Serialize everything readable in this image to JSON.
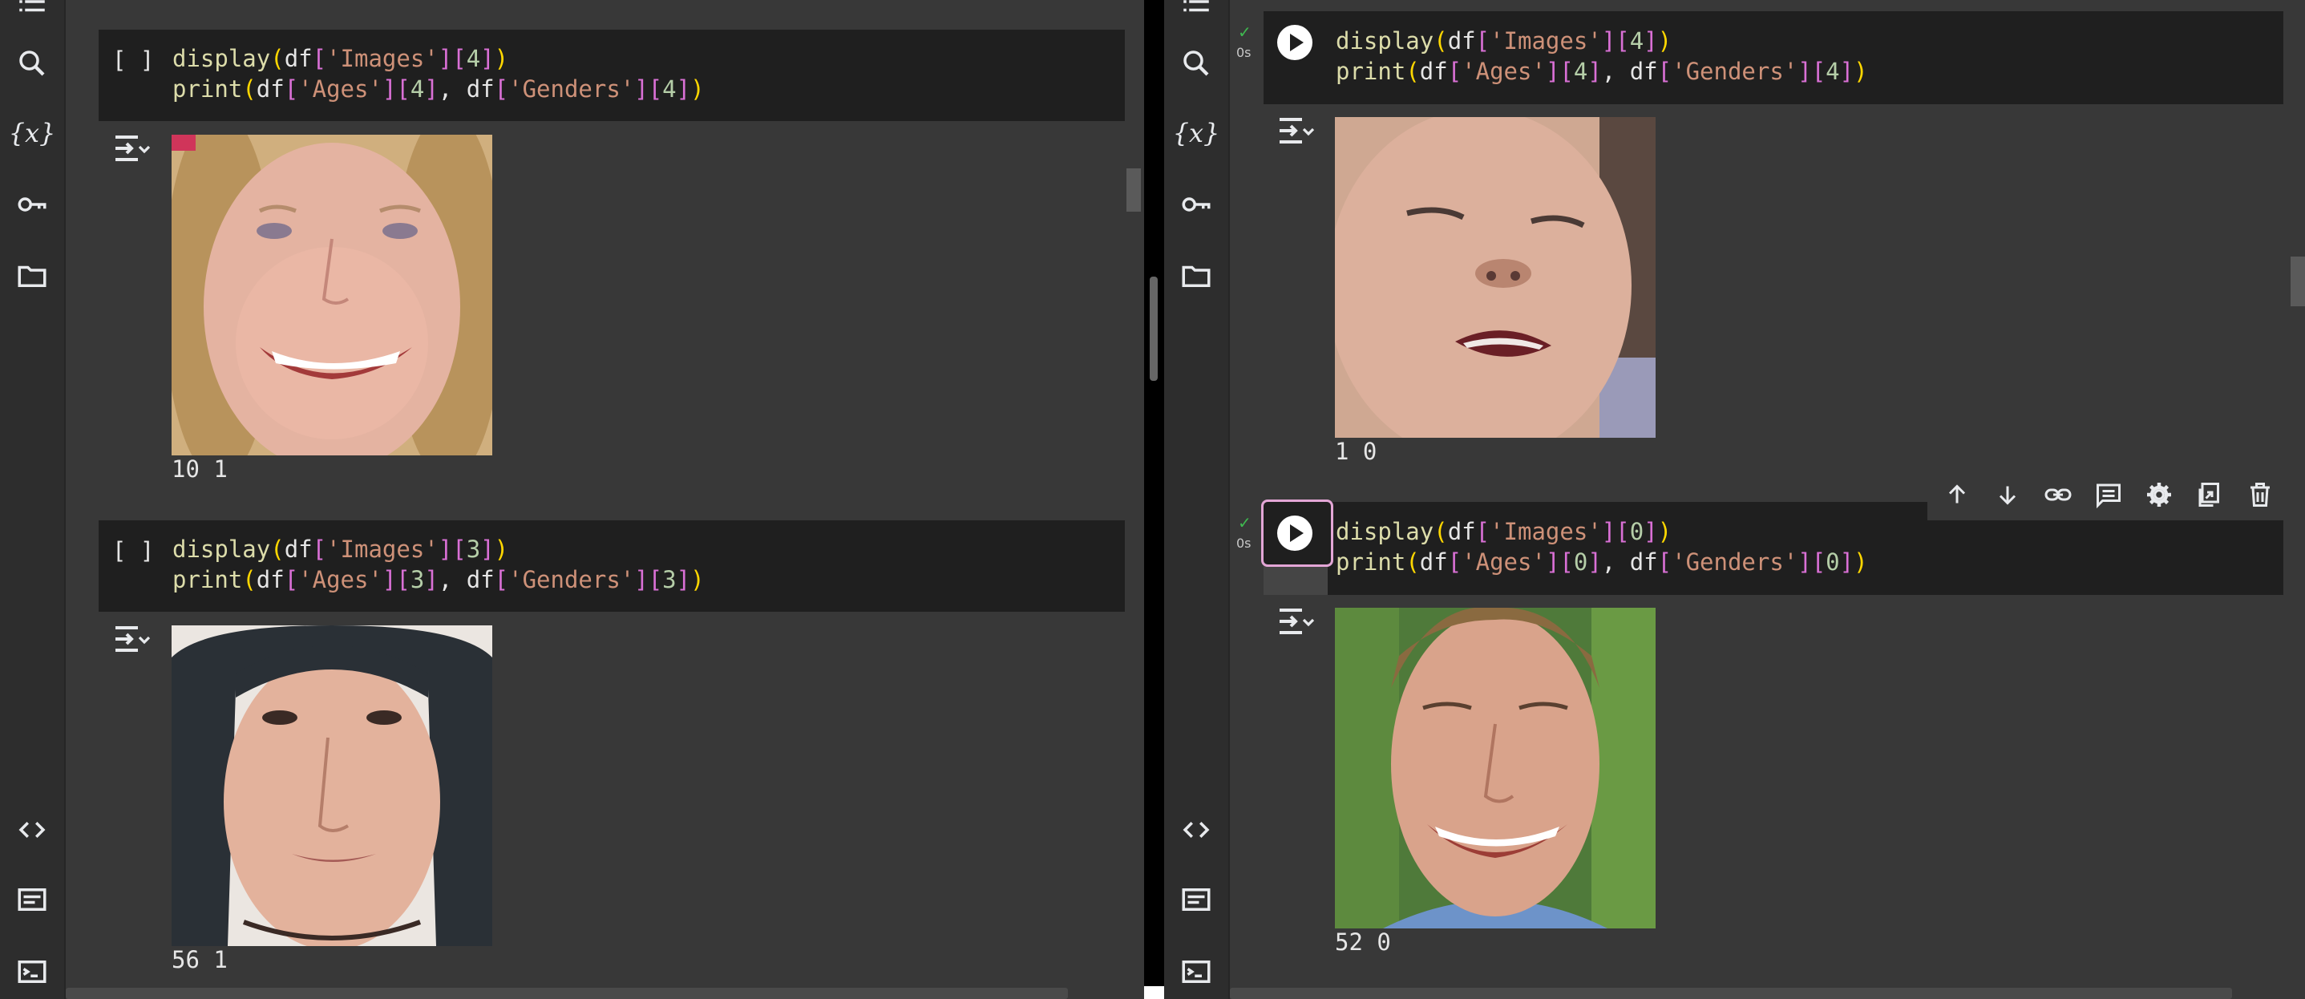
{
  "rail_icons": [
    "list-icon",
    "search-icon",
    "variables-icon",
    "key-icon",
    "folder-icon",
    "code-icon",
    "snippets-icon",
    "terminal-icon"
  ],
  "variables_glyph": "{x}",
  "empty_run_indicator": "[ ]",
  "left": {
    "cells": [
      {
        "code": [
          "display(df['Images'][4])",
          "print(df['Ages'][4], df['Genders'][4])"
        ],
        "output_text": "10 1",
        "image_name": "child-face-image"
      },
      {
        "code": [
          "display(df['Images'][3])",
          "print(df['Ages'][3], df['Genders'][3])"
        ],
        "output_text": "56 1",
        "image_name": "woman-face-image"
      }
    ]
  },
  "right": {
    "cells": [
      {
        "status_check": "✓",
        "status_time": "0s",
        "code": [
          "display(df['Images'][4])",
          "print(df['Ages'][4], df['Genders'][4])"
        ],
        "output_text": "1 0",
        "image_name": "baby-face-image"
      },
      {
        "status_check": "✓",
        "status_time": "0s",
        "code": [
          "display(df['Images'][0])",
          "print(df['Ages'][0], df['Genders'][0])"
        ],
        "output_text": "52 0",
        "image_name": "man-face-image"
      }
    ],
    "toolbar": [
      "move-up-icon",
      "move-down-icon",
      "link-icon",
      "comment-icon",
      "settings-icon",
      "mirror-cell-icon",
      "delete-icon"
    ]
  },
  "colors": {
    "background": "#383838",
    "code_background": "#1f1f1f",
    "rail_background": "#2d2d2d",
    "function": "#dcdcaa",
    "bracket_outer": "#ffd700",
    "bracket_inner": "#da70d6",
    "string": "#ce9178",
    "number": "#b5cea8",
    "success": "#3fb950",
    "active_frame": "#e3a6d6"
  }
}
